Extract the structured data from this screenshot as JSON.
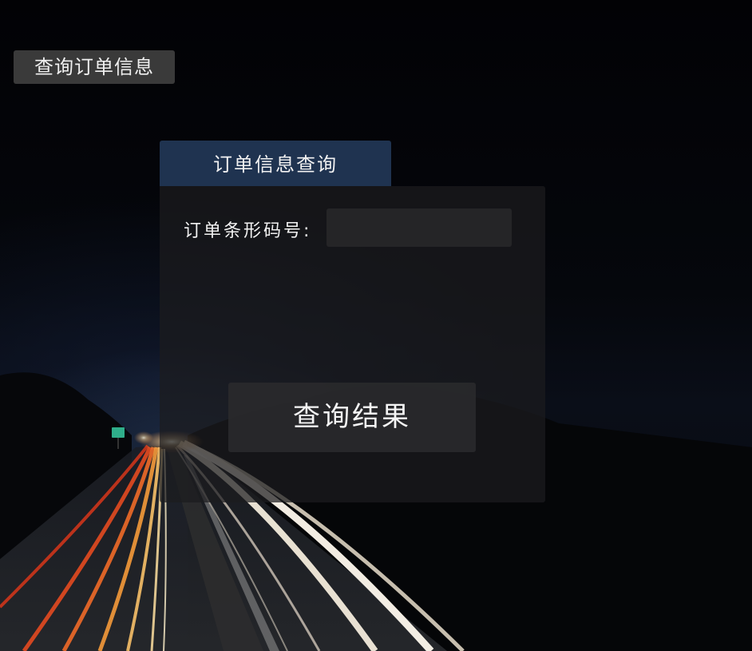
{
  "top_button": {
    "label": "查询订单信息"
  },
  "query_tab": {
    "title": "订单信息查询"
  },
  "form": {
    "barcode_label": "订单条形码号:",
    "barcode_value": "",
    "barcode_placeholder": ""
  },
  "result_button": {
    "label": "查询结果"
  },
  "background": {
    "image_subject": "night-highway-light-trails-photo",
    "colors": {
      "sky": "#030306",
      "trail_red": "#e0421a",
      "trail_orange": "#f5a43a",
      "trail_white": "#fff6e0",
      "tab_blue": "#1f3350"
    }
  }
}
